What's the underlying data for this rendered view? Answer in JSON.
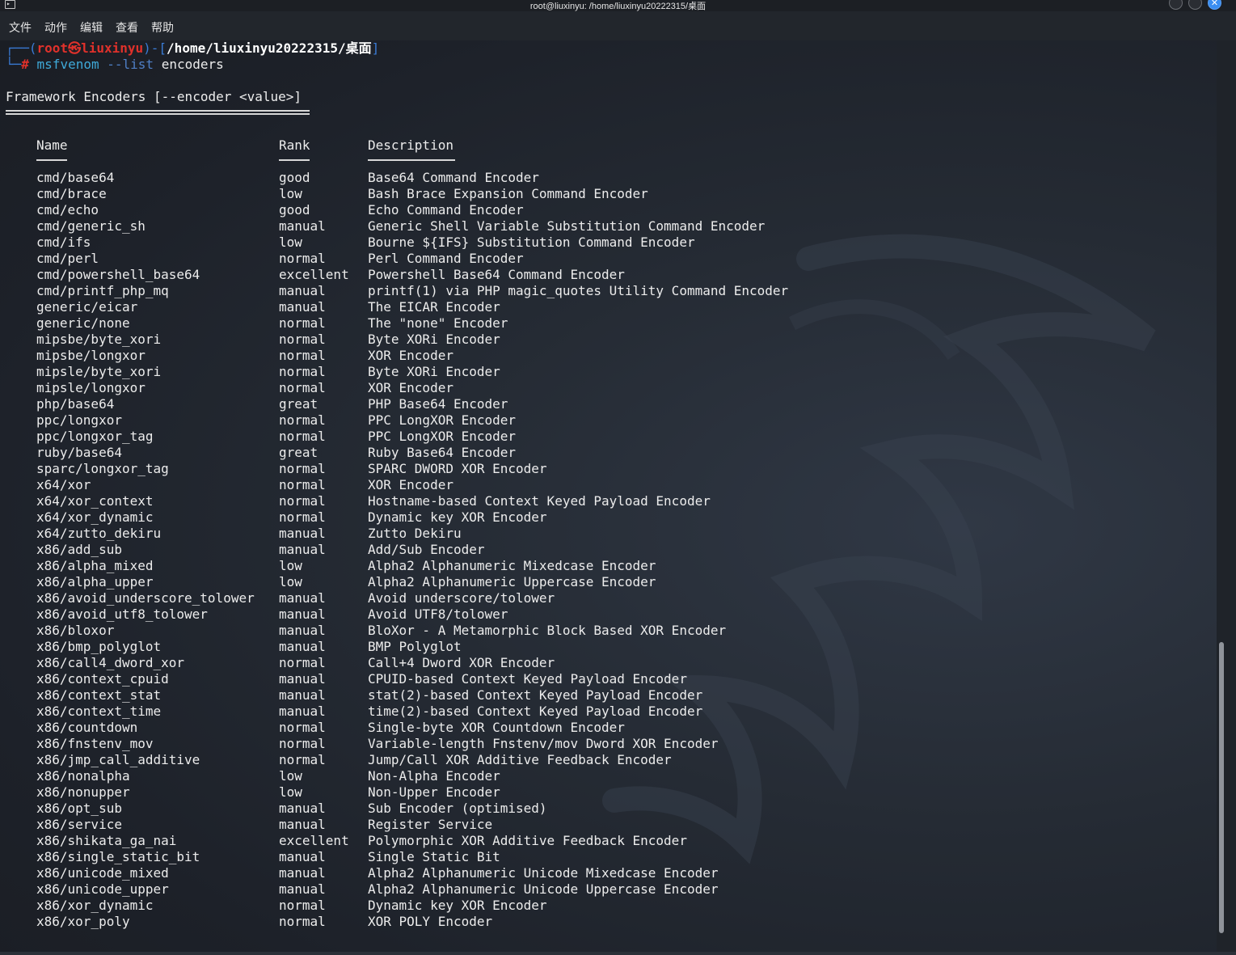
{
  "window": {
    "title": "root@liuxinyu: /home/liuxinyu20222315/桌面"
  },
  "menu": [
    "文件",
    "动作",
    "编辑",
    "查看",
    "帮助"
  ],
  "prompt": {
    "box_open": "┌──(",
    "user": "root",
    "skull": "㉿",
    "host": "liuxinyu",
    "sep": ")-[",
    "path": "/home/liuxinyu20222315/桌面",
    "box_close": "]",
    "line2_prefix": "└─",
    "hash": "#",
    "cmd": "msfvenom",
    "opt": "--list",
    "arg": "encoders"
  },
  "section_title": "Framework Encoders [--encoder <value>]",
  "headers": {
    "name": "Name",
    "rank": "Rank",
    "desc": "Description"
  },
  "encoders": [
    [
      "cmd/base64",
      "good",
      "Base64 Command Encoder"
    ],
    [
      "cmd/brace",
      "low",
      "Bash Brace Expansion Command Encoder"
    ],
    [
      "cmd/echo",
      "good",
      "Echo Command Encoder"
    ],
    [
      "cmd/generic_sh",
      "manual",
      "Generic Shell Variable Substitution Command Encoder"
    ],
    [
      "cmd/ifs",
      "low",
      "Bourne ${IFS} Substitution Command Encoder"
    ],
    [
      "cmd/perl",
      "normal",
      "Perl Command Encoder"
    ],
    [
      "cmd/powershell_base64",
      "excellent",
      "Powershell Base64 Command Encoder"
    ],
    [
      "cmd/printf_php_mq",
      "manual",
      "printf(1) via PHP magic_quotes Utility Command Encoder"
    ],
    [
      "generic/eicar",
      "manual",
      "The EICAR Encoder"
    ],
    [
      "generic/none",
      "normal",
      "The \"none\" Encoder"
    ],
    [
      "mipsbe/byte_xori",
      "normal",
      "Byte XORi Encoder"
    ],
    [
      "mipsbe/longxor",
      "normal",
      "XOR Encoder"
    ],
    [
      "mipsle/byte_xori",
      "normal",
      "Byte XORi Encoder"
    ],
    [
      "mipsle/longxor",
      "normal",
      "XOR Encoder"
    ],
    [
      "php/base64",
      "great",
      "PHP Base64 Encoder"
    ],
    [
      "ppc/longxor",
      "normal",
      "PPC LongXOR Encoder"
    ],
    [
      "ppc/longxor_tag",
      "normal",
      "PPC LongXOR Encoder"
    ],
    [
      "ruby/base64",
      "great",
      "Ruby Base64 Encoder"
    ],
    [
      "sparc/longxor_tag",
      "normal",
      "SPARC DWORD XOR Encoder"
    ],
    [
      "x64/xor",
      "normal",
      "XOR Encoder"
    ],
    [
      "x64/xor_context",
      "normal",
      "Hostname-based Context Keyed Payload Encoder"
    ],
    [
      "x64/xor_dynamic",
      "normal",
      "Dynamic key XOR Encoder"
    ],
    [
      "x64/zutto_dekiru",
      "manual",
      "Zutto Dekiru"
    ],
    [
      "x86/add_sub",
      "manual",
      "Add/Sub Encoder"
    ],
    [
      "x86/alpha_mixed",
      "low",
      "Alpha2 Alphanumeric Mixedcase Encoder"
    ],
    [
      "x86/alpha_upper",
      "low",
      "Alpha2 Alphanumeric Uppercase Encoder"
    ],
    [
      "x86/avoid_underscore_tolower",
      "manual",
      "Avoid underscore/tolower"
    ],
    [
      "x86/avoid_utf8_tolower",
      "manual",
      "Avoid UTF8/tolower"
    ],
    [
      "x86/bloxor",
      "manual",
      "BloXor - A Metamorphic Block Based XOR Encoder"
    ],
    [
      "x86/bmp_polyglot",
      "manual",
      "BMP Polyglot"
    ],
    [
      "x86/call4_dword_xor",
      "normal",
      "Call+4 Dword XOR Encoder"
    ],
    [
      "x86/context_cpuid",
      "manual",
      "CPUID-based Context Keyed Payload Encoder"
    ],
    [
      "x86/context_stat",
      "manual",
      "stat(2)-based Context Keyed Payload Encoder"
    ],
    [
      "x86/context_time",
      "manual",
      "time(2)-based Context Keyed Payload Encoder"
    ],
    [
      "x86/countdown",
      "normal",
      "Single-byte XOR Countdown Encoder"
    ],
    [
      "x86/fnstenv_mov",
      "normal",
      "Variable-length Fnstenv/mov Dword XOR Encoder"
    ],
    [
      "x86/jmp_call_additive",
      "normal",
      "Jump/Call XOR Additive Feedback Encoder"
    ],
    [
      "x86/nonalpha",
      "low",
      "Non-Alpha Encoder"
    ],
    [
      "x86/nonupper",
      "low",
      "Non-Upper Encoder"
    ],
    [
      "x86/opt_sub",
      "manual",
      "Sub Encoder (optimised)"
    ],
    [
      "x86/service",
      "manual",
      "Register Service"
    ],
    [
      "x86/shikata_ga_nai",
      "excellent",
      "Polymorphic XOR Additive Feedback Encoder"
    ],
    [
      "x86/single_static_bit",
      "manual",
      "Single Static Bit"
    ],
    [
      "x86/unicode_mixed",
      "manual",
      "Alpha2 Alphanumeric Unicode Mixedcase Encoder"
    ],
    [
      "x86/unicode_upper",
      "manual",
      "Alpha2 Alphanumeric Unicode Uppercase Encoder"
    ],
    [
      "x86/xor_dynamic",
      "normal",
      "Dynamic key XOR Encoder"
    ],
    [
      "x86/xor_poly",
      "normal",
      "XOR POLY Encoder"
    ]
  ]
}
